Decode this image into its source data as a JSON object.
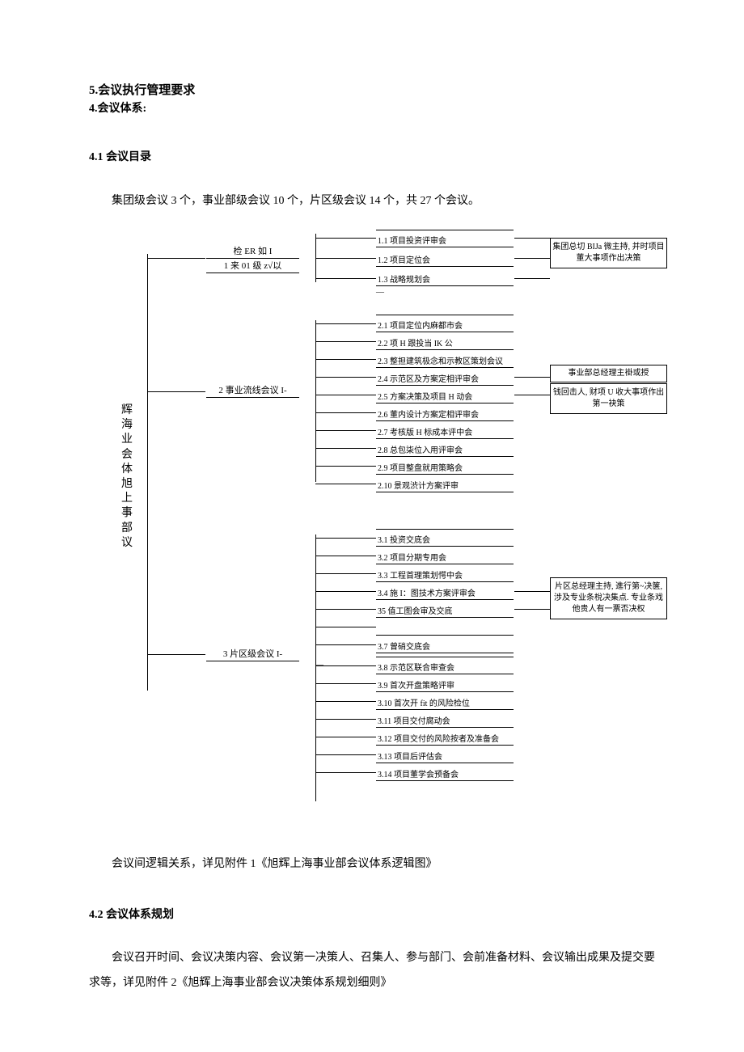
{
  "headings": {
    "h5": "5.会议执行管理要求",
    "h4": "4.会议体系:",
    "s41": "4.1 会议目录",
    "intro": "集团级会议 3 个，事业部级会议 10 个，片区级会议 14 个，共 27 个会议。",
    "s42": "4.2 会议体系规划"
  },
  "root_label": "辉海业会体旭上事部议",
  "group1": {
    "label_top": "检 ER 如  I",
    "label_bot": "1 来 01 级 z√以",
    "items": [
      "1.1 项目投资评审会",
      "1.2 项目定位会",
      "1.3 战略规划会"
    ],
    "anno": "集团总切 BIJa 微主持, 并时项目董大事项作出决策"
  },
  "group2": {
    "label": "2 事业流线会议 I-",
    "items": [
      "2.1 项目定位内麻都市会",
      "2.2 项 H 跟投当 IK 公",
      "2.3 整担建筑极念和示教区策划会议",
      "2.4 示范区及方案定相评审会",
      "2.5 方案决策及项目 H 动会",
      "2.6 董内设计方案定相评审会",
      "2.7 考核版 H 标成本评中会",
      "2.8 总包柒位入用评审会",
      "2.9 项目整盘就用策略会",
      "2.10 景观渋计方案评审"
    ],
    "anno_top": "事业部总经理主褂或授",
    "anno_bot": "钱回击人, 财项 U 收大事项作出第一袂策"
  },
  "group3": {
    "label": "3 片区级会议 I-",
    "items": [
      "3.1 投资交底会",
      "3.2 项目分期专用会",
      "3.3 工程首理策划愕中会",
      "3.4 施 I：图技术方案评审会",
      "35 值工图会审及交底",
      "",
      "3.7 曾硝交底会",
      "3.8 示范区联合审查会",
      "3.9 首次开盘策略评审",
      "3.10 首次开 fit 的风险检位",
      "3.11 项目交付腐动会",
      "3.12 项目交付的风险按者及准备会",
      "3.13 项目后评估会",
      "3.14 项目董学会预备会"
    ],
    "anno": "片区总经理主持, 進行第~决箧, 涉及专业条梲决集点. 专业条戏他贵人有一票否决权"
  },
  "footer": {
    "p1": "会议间逻辑关系，详见附件 1《旭辉上海事业部会议体系逻辑图》",
    "p2": "会议召开时间、会议决策内容、会议第一决策人、召集人、参与部门、会前准备材料、会议输出成果及提交要求等，详见附件 2《旭辉上海事业部会议决策体系规划细则》"
  }
}
